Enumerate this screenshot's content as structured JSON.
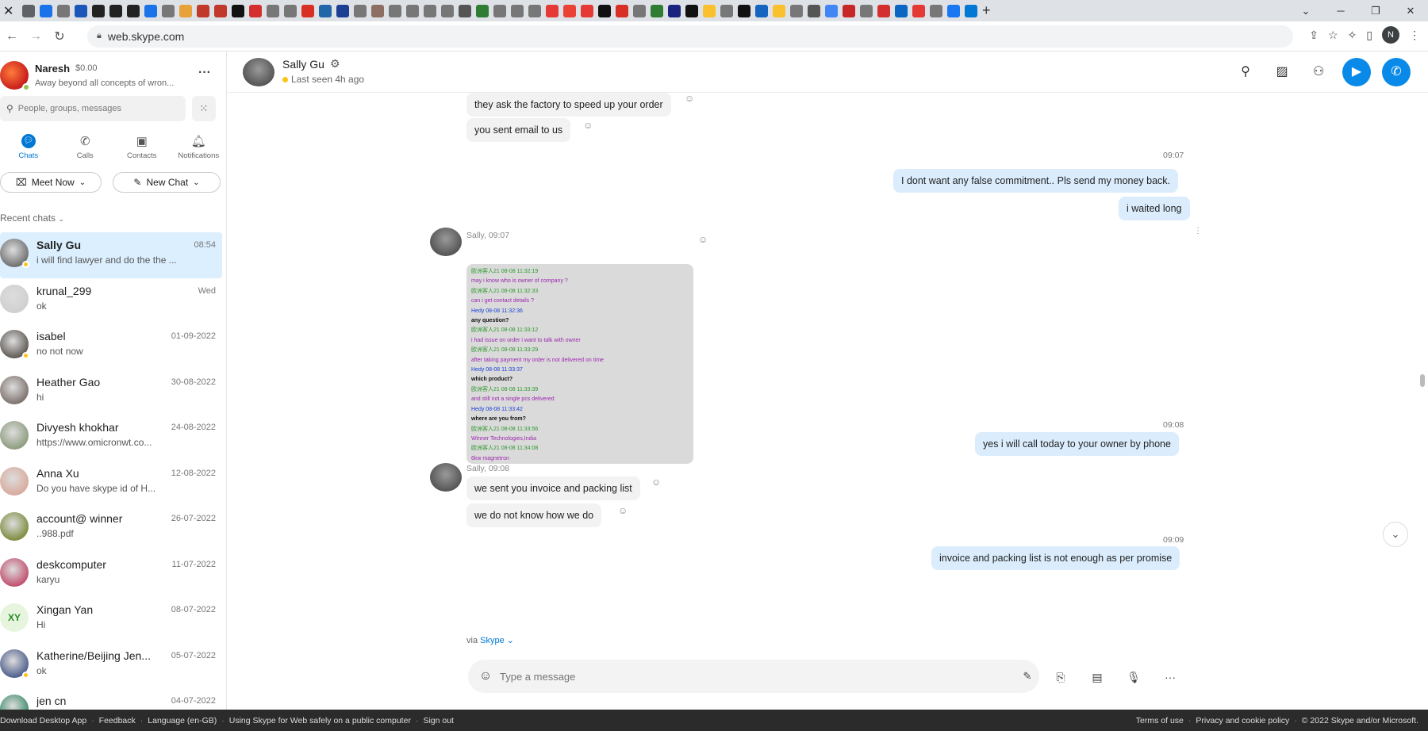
{
  "browser": {
    "url": "web.skype.com",
    "profile_initial": "N",
    "favicon_colors": [
      "#5f6368",
      "#1a73e8",
      "#777",
      "#1a57b8",
      "#222",
      "#222",
      "#222",
      "#1a73e8",
      "#777",
      "#e8a23a",
      "#c0392b",
      "#c0392b",
      "#111",
      "#d32f2f",
      "#777",
      "#777",
      "#d93025",
      "#2266aa",
      "#1c3f94",
      "#777",
      "#8d6e63",
      "#777",
      "#777",
      "#777",
      "#777",
      "#555",
      "#2e7d32",
      "#777",
      "#777",
      "#777",
      "#e53935",
      "#ea4335",
      "#e53935",
      "#111",
      "#d93025",
      "#777",
      "#2e7d32",
      "#1a237e",
      "#111",
      "#fbc02d",
      "#777",
      "#111",
      "#1565c0",
      "#fbc02d",
      "#777",
      "#555",
      "#4285f4",
      "#c62828",
      "#777",
      "#d32f2f",
      "#0a66c2",
      "#e53935",
      "#777",
      "#1877f2",
      "#0078d4"
    ],
    "tab_close": "✕",
    "new_tab": "+",
    "win_controls": [
      "⌄",
      "─",
      "❐",
      "✕"
    ]
  },
  "profile": {
    "name": "Naresh",
    "balance": "$0.00",
    "status": "Away beyond all concepts of wron...",
    "more": "···"
  },
  "search": {
    "placeholder": "People, groups, messages"
  },
  "nav": [
    {
      "label": "Chats",
      "icon": "chat-icon"
    },
    {
      "label": "Calls",
      "icon": "phone-icon"
    },
    {
      "label": "Contacts",
      "icon": "contacts-icon"
    },
    {
      "label": "Notifications",
      "icon": "bell-icon"
    }
  ],
  "actions": {
    "meet_now": "Meet Now",
    "new_chat": "New Chat"
  },
  "recent_header": "Recent chats",
  "chats": [
    {
      "name": "Sally Gu",
      "date": "08:54",
      "preview": "i will find lawyer and do the the ...",
      "avatar": "#6b6b6b",
      "status": true
    },
    {
      "name": "krunal_299",
      "date": "Wed",
      "preview": "ok",
      "avatar": "#cfcfcf",
      "status": false
    },
    {
      "name": "isabel",
      "date": "01-09-2022",
      "preview": "no not now",
      "avatar": "#5a5550",
      "status": true
    },
    {
      "name": "Heather Gao",
      "date": "30-08-2022",
      "preview": "hi",
      "avatar": "#7a6e6a",
      "status": false
    },
    {
      "name": "Divyesh khokhar",
      "date": "24-08-2022",
      "preview": "https://www.omicronwt.co...",
      "avatar": "#8a9a7a",
      "status": false
    },
    {
      "name": "Anna Xu",
      "date": "12-08-2022",
      "preview": "Do you have skype id of H...",
      "avatar": "#d9a89a",
      "status": false
    },
    {
      "name": "account@ winner",
      "date": "26-07-2022",
      "preview": "..988.pdf",
      "avatar": "#7a8a3a",
      "status": false
    },
    {
      "name": "deskcomputer",
      "date": "11-07-2022",
      "preview": "karyu",
      "avatar": "#c04a6a",
      "status": false
    },
    {
      "name": "Xingan  Yan",
      "date": "08-07-2022",
      "preview": "Hi",
      "avatar": "init",
      "initials": "XY",
      "status": false
    },
    {
      "name": "Katherine/Beijing Jen...",
      "date": "05-07-2022",
      "preview": "ok",
      "avatar": "#4a5a8a",
      "status": true
    },
    {
      "name": "jen cn",
      "date": "04-07-2022",
      "preview": "",
      "avatar": "#3a8a6a",
      "status": false
    }
  ],
  "conversation": {
    "name": "Sally Gu",
    "last_seen": "Last seen 4h ago",
    "messages": {
      "m1": "they ask the factory to speed up your order",
      "m2": "you sent email to us",
      "t1": "09:07",
      "m3": "I dont want any false commitment.. Pls send my money back.",
      "m4": "i waited long",
      "sender1": "Sally, 09:07",
      "t2": "09:08",
      "m5": "yes i will call today to your owner by phone",
      "sender2": "Sally, 09:08",
      "m6": "we sent you invoice and packing list",
      "m7": "we do not know how we do",
      "t3": "09:09",
      "m8": "invoice and packing list is not enough as per promise"
    },
    "screenshot_lines": [
      {
        "text": "欧洲客人21 08-08 11:32:19",
        "color": "#2e9a2e"
      },
      {
        "text": "may i know who is owner of company ?",
        "color": "#9c27b0"
      },
      {
        "text": "欧洲客人21 08-08 11:32:33",
        "color": "#2e9a2e"
      },
      {
        "text": "can i get contact details ?",
        "color": "#9c27b0"
      },
      {
        "text": "Hedy 08-08 11:32:36",
        "color": "#1a3fd6"
      },
      {
        "text": "any question?",
        "color": "#111"
      },
      {
        "text": "欧洲客人21 08-08 11:33:12",
        "color": "#2e9a2e"
      },
      {
        "text": "i had issue on order i want to talk with owner",
        "color": "#9c27b0"
      },
      {
        "text": "欧洲客人21 08-08 11:33:29",
        "color": "#2e9a2e"
      },
      {
        "text": "after taking payment my order is not delivered on time",
        "color": "#9c27b0"
      },
      {
        "text": "Hedy 08-08 11:33:37",
        "color": "#1a3fd6"
      },
      {
        "text": "which product?",
        "color": "#111"
      },
      {
        "text": "欧洲客人21 08-08 11:33:39",
        "color": "#2e9a2e"
      },
      {
        "text": "and still not a single pcs delivered",
        "color": "#9c27b0"
      },
      {
        "text": "Hedy 08-08 11:33:42",
        "color": "#1a3fd6"
      },
      {
        "text": "where are you from?",
        "color": "#111"
      },
      {
        "text": "欧洲客人21 08-08 11:33:56",
        "color": "#2e9a2e"
      },
      {
        "text": "Winner Technologies,India",
        "color": "#9c27b0"
      },
      {
        "text": "欧洲客人21 08-08 11:34:08",
        "color": "#2e9a2e"
      },
      {
        "text": "6kw magnetron",
        "color": "#9c27b0"
      }
    ]
  },
  "composer": {
    "via": "via",
    "via_link": "Skype",
    "placeholder": "Type a message"
  },
  "footer": {
    "left": [
      "Download Desktop App",
      "Feedback",
      "Language (en-GB)",
      "Using Skype for Web safely on a public computer",
      "Sign out"
    ],
    "right": [
      "Terms of use",
      "Privacy and cookie policy",
      "© 2022 Skype and/or Microsoft."
    ]
  }
}
